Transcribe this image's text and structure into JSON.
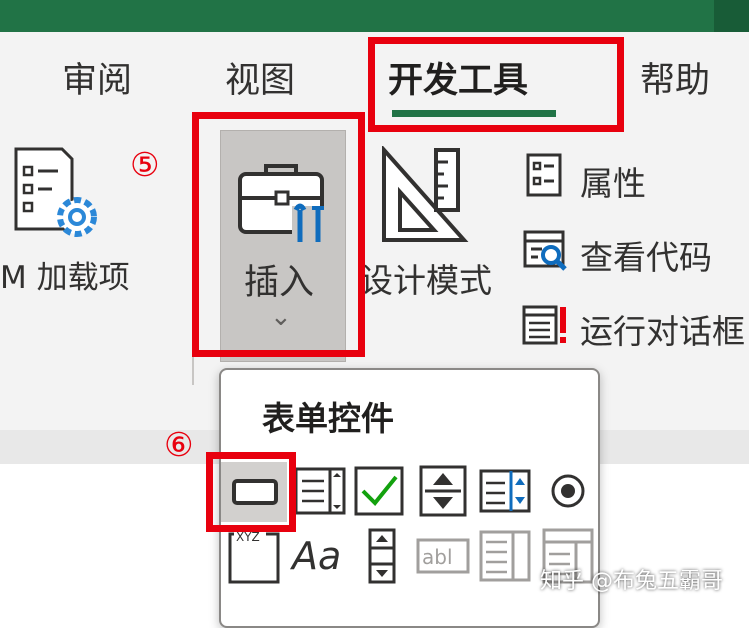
{
  "tabs": [
    {
      "label": "审阅",
      "active": false
    },
    {
      "label": "视图",
      "active": false
    },
    {
      "label": "开发工具",
      "active": true
    },
    {
      "label": "帮助",
      "active": false
    }
  ],
  "ribbon": {
    "addins_label": "M 加载项",
    "insert_label": "插入",
    "insert_chevron": "⌄",
    "design_mode_label": "设计模式",
    "commands": [
      {
        "label": "属性",
        "icon": "properties-icon"
      },
      {
        "label": "查看代码",
        "icon": "view-code-icon"
      },
      {
        "label": "运行对话框",
        "icon": "run-dialog-icon"
      }
    ]
  },
  "annotations": {
    "step5": "⑤",
    "step6": "⑥"
  },
  "form_controls": {
    "title": "表单控件",
    "row1": [
      "button-icon",
      "combo-box-icon",
      "check-box-icon",
      "spin-button-icon",
      "list-box-icon",
      "option-button-icon"
    ],
    "label_control_text": "Aa",
    "row2": [
      "group-box-icon",
      "label-icon",
      "scroll-bar-icon",
      "text-field-icon",
      "combo-list-edit-icon",
      "combo-dropdown-edit-icon"
    ],
    "selected": "button-icon"
  },
  "watermark": "知乎 @布兔五霸哥",
  "colors": {
    "accent": "#217346",
    "annotation_red": "#e8000e",
    "ribbon_bg": "#f3f3f3",
    "selected_bg": "#c8c6c4"
  }
}
